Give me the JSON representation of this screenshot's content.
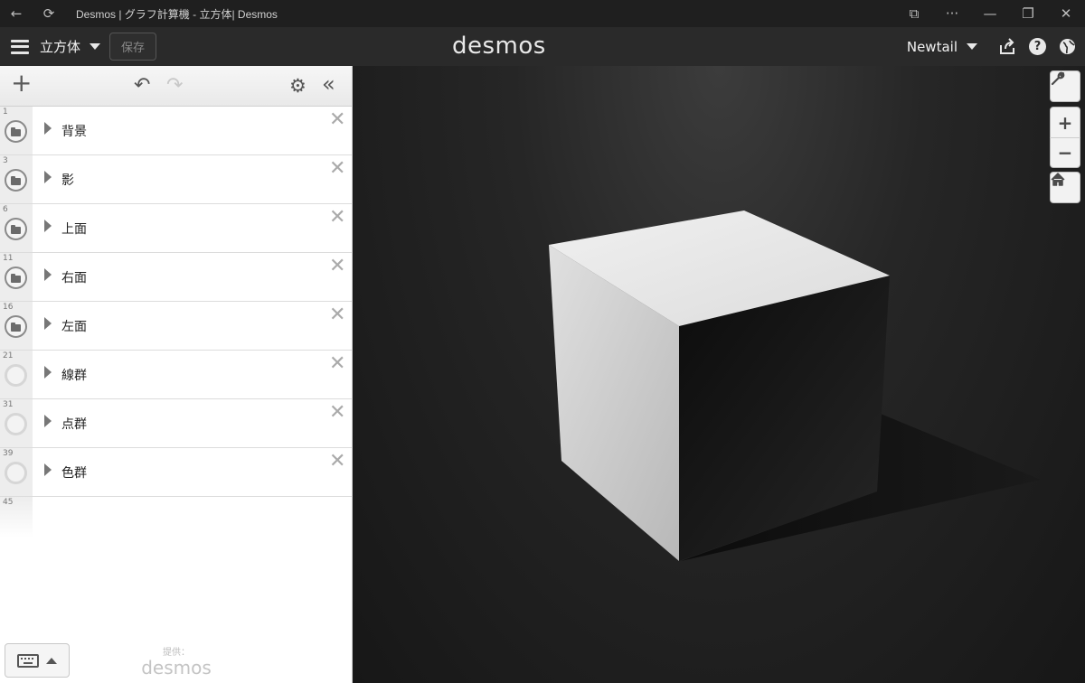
{
  "window": {
    "title": "Desmos | グラフ計算機 - 立方体| Desmos",
    "back_icon": "arrow-left-icon",
    "refresh_icon": "refresh-icon"
  },
  "header": {
    "graph_title": "立方体",
    "save_label": "保存",
    "logo": "desmos",
    "user_name": "Newtail",
    "help_glyph": "?"
  },
  "toolbar": {
    "add_glyph": "+",
    "undo_glyph": "↶",
    "redo_glyph": "↷",
    "gear_glyph": "⚙",
    "collapse_glyph": "«"
  },
  "expressions": [
    {
      "index": "1",
      "label": "背景",
      "type": "folder"
    },
    {
      "index": "3",
      "label": "影",
      "type": "folder"
    },
    {
      "index": "6",
      "label": "上面",
      "type": "folder"
    },
    {
      "index": "11",
      "label": "右面",
      "type": "folder"
    },
    {
      "index": "16",
      "label": "左面",
      "type": "folder"
    },
    {
      "index": "21",
      "label": "線群",
      "type": "empty"
    },
    {
      "index": "31",
      "label": "点群",
      "type": "empty"
    },
    {
      "index": "39",
      "label": "色群",
      "type": "empty"
    }
  ],
  "next_index": "45",
  "delete_glyph": "✕",
  "footer": {
    "powered_by": "提供：",
    "powered_logo": "desmos"
  },
  "graph_controls": {
    "wrench_glyph": "🔧",
    "zoom_in": "+",
    "zoom_out": "−",
    "home_glyph": "⌂"
  },
  "colors": {
    "graph_bg": "#1c1c1c",
    "header_bg": "#2a2a2a",
    "cube_top": "#e8e8e8",
    "cube_left": "#cfcfcf",
    "cube_right": "#151515"
  }
}
